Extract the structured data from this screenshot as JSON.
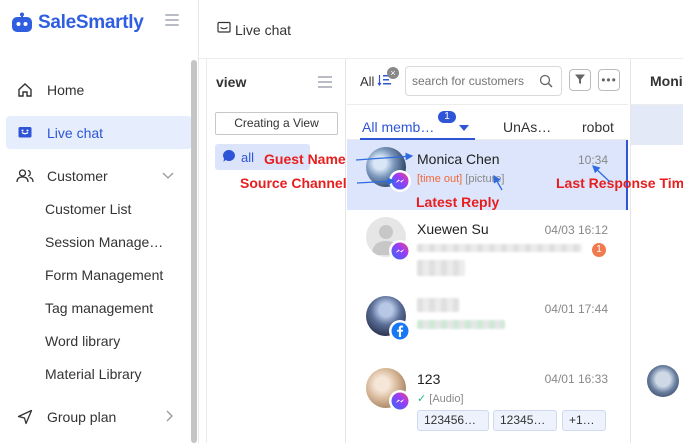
{
  "brand": {
    "name": "SaleSmartly",
    "logo_icon": "robot-logo-icon"
  },
  "sidebar": {
    "items": [
      {
        "label": "Home",
        "icon": "home-icon"
      },
      {
        "label": "Live chat",
        "icon": "chat-icon",
        "active": true
      },
      {
        "label": "Customer",
        "icon": "users-icon",
        "expanded": true
      },
      {
        "label": "Group plan",
        "icon": "send-icon"
      }
    ],
    "customer_sub": [
      "Customer List",
      "Session Manage…",
      "Form Management",
      "Tag management",
      "Word library",
      "Material Library"
    ]
  },
  "topbar": {
    "title": "Live chat"
  },
  "views": {
    "title": "view",
    "create_button": "Creating a View",
    "items": [
      {
        "label": "all"
      }
    ]
  },
  "conversations": {
    "filter_label": "All",
    "search_placeholder": "search for customers",
    "tabs": [
      {
        "label": "All memb…",
        "badge": "1",
        "active": true
      },
      {
        "label": "UnAs…"
      },
      {
        "label": "robot"
      }
    ],
    "items": [
      {
        "name": "Monica Chen",
        "time": "10:34",
        "message_tag": "[time out]",
        "message_extra": "[picture]",
        "channel": "messenger-icon",
        "selected": true
      },
      {
        "name": "Xuewen Su",
        "time": "04/03 16:12",
        "unread": "1",
        "channel": "messenger-icon"
      },
      {
        "name": "",
        "time": "04/01 17:44",
        "channel": "facebook-icon"
      },
      {
        "name": "123",
        "time": "04/01 16:33",
        "message": "[Audio]",
        "channel": "messenger-icon",
        "chips": [
          "123456…",
          "12345…",
          "+1…"
        ]
      }
    ]
  },
  "right": {
    "contact_name": "Moni"
  },
  "annotations": {
    "guest_name": "Guest Name",
    "source_channel": "Source Channel",
    "latest_reply": "Latest Reply",
    "last_response_time": "Last Response Time"
  },
  "colors": {
    "accent": "#2e55d6",
    "annotation": "#e81e1e",
    "active_bg": "#e6edfc"
  }
}
